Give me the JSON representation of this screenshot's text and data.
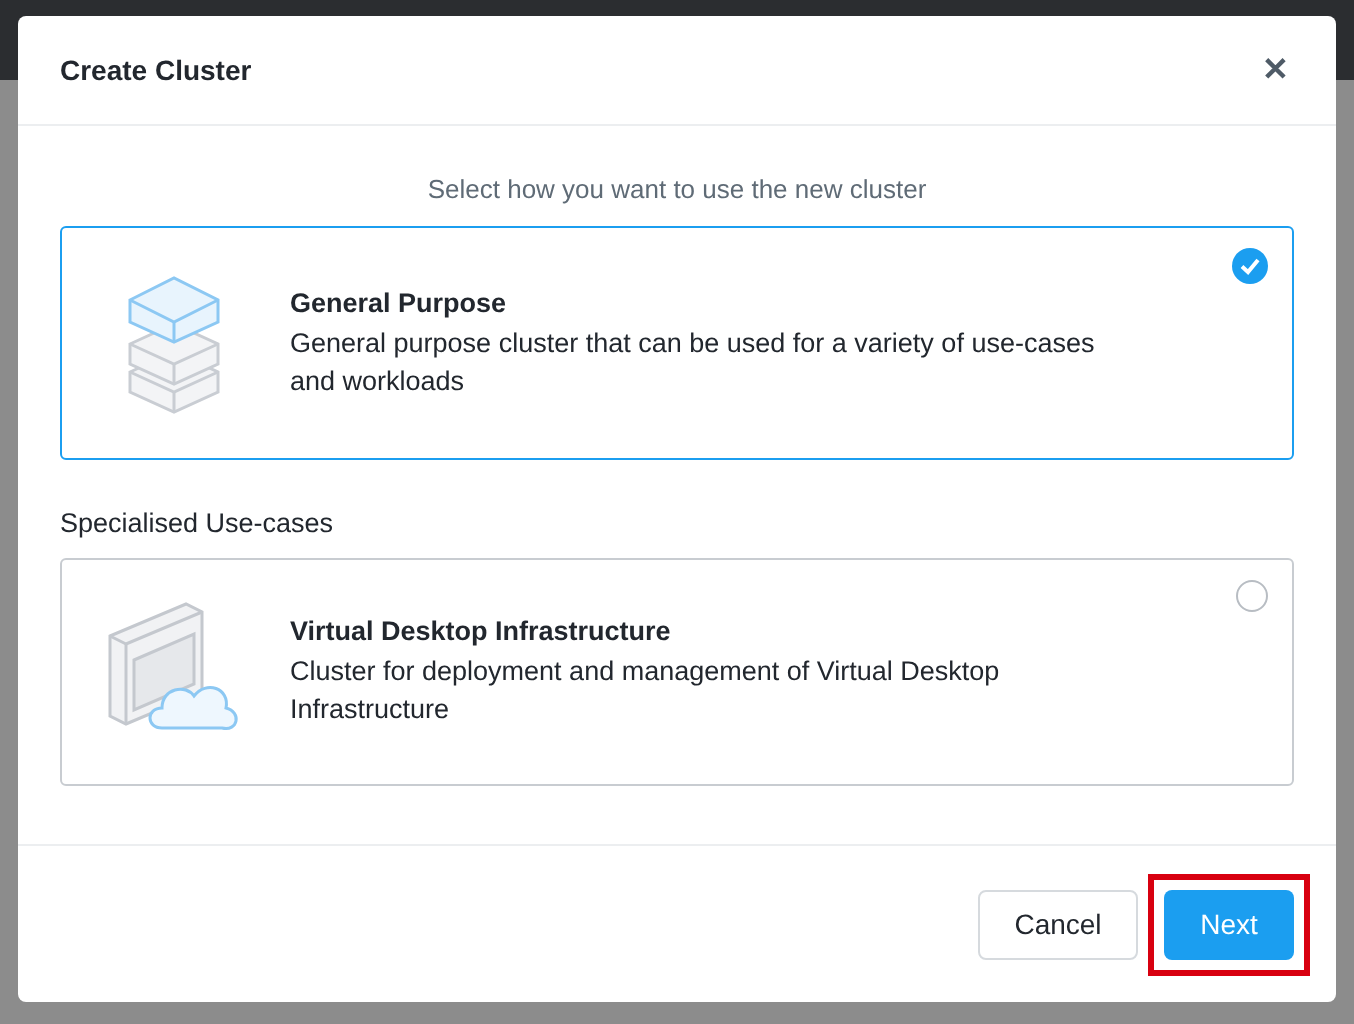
{
  "dialog": {
    "title": "Create Cluster",
    "close": "✕",
    "subtitle": "Select how you want to use the new cluster",
    "sections": [
      {
        "options": [
          {
            "kind": "stack",
            "title": "General Purpose",
            "description": "General purpose cluster that can be used for a variety of use-cases and workloads",
            "selected": true
          }
        ]
      },
      {
        "heading": "Specialised Use-cases",
        "options": [
          {
            "kind": "desktop",
            "title": "Virtual Desktop Infrastructure",
            "description": "Cluster for deployment and management of Virtual Desktop Infrastructure",
            "selected": false
          }
        ]
      }
    ],
    "buttons": [
      {
        "label": "Cancel",
        "kind": "secondary"
      },
      {
        "label": "Next",
        "kind": "primary",
        "highlighted": true
      }
    ]
  }
}
